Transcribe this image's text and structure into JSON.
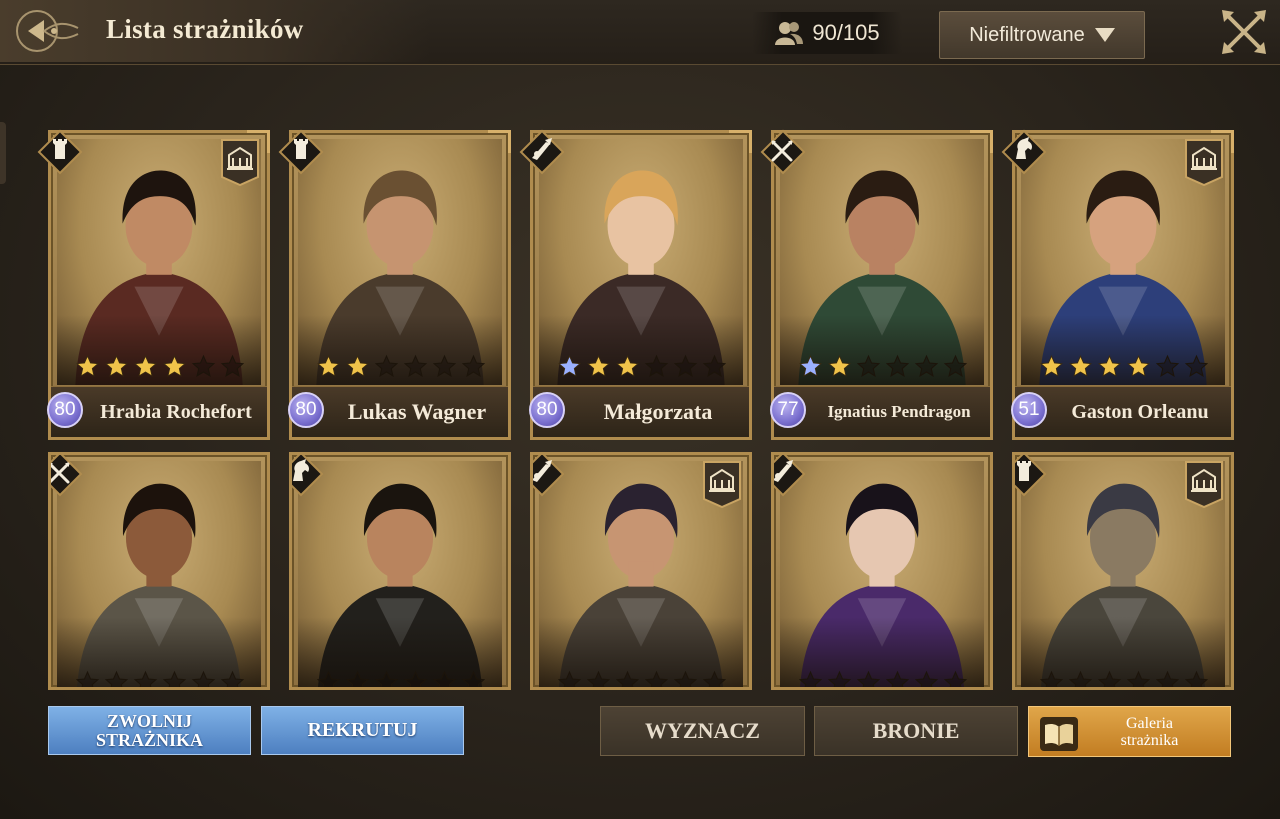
{
  "header": {
    "title": "Lista strażników",
    "capacity": "90/105",
    "filter_label": "Niefiltrowane"
  },
  "guards": [
    {
      "name": "Hrabia Rochefort",
      "level": "80",
      "stars": 4,
      "blue_stars": 0,
      "class": "tower-icon",
      "building": true
    },
    {
      "name": "Lukas Wagner",
      "level": "80",
      "stars": 2,
      "blue_stars": 0,
      "class": "tower-icon",
      "building": false
    },
    {
      "name": "Małgorzata",
      "level": "80",
      "stars": 2,
      "blue_stars": 1,
      "class": "musket-icon",
      "building": false
    },
    {
      "name": "Ignatius Pendragon",
      "level": "77",
      "stars": 1,
      "blue_stars": 1,
      "class": "crossed-swords-icon",
      "building": false
    },
    {
      "name": "Gaston Orleanu",
      "level": "51",
      "stars": 4,
      "blue_stars": 0,
      "class": "horse-icon",
      "building": true
    },
    {
      "class": "crossed-swords-icon",
      "building": false
    },
    {
      "class": "horse-icon",
      "building": false
    },
    {
      "class": "musket-icon",
      "building": true
    },
    {
      "class": "musket-icon",
      "building": false
    },
    {
      "class": "tower-icon",
      "building": true
    }
  ],
  "buttons": {
    "dismiss": "ZWOLNIJ STRAŻNIKA",
    "recruit": "REKRUTUJ",
    "assign": "WYZNACZ",
    "defend": "BRONIE",
    "gallery": "Galeria strażnika"
  },
  "colors": {
    "gold_star": "#f0c34a",
    "blue_star": "#9ab0ff",
    "level_badge": "#7a6fcf",
    "blue_button": "#5a8ccc",
    "gold_button": "#d08f33"
  }
}
